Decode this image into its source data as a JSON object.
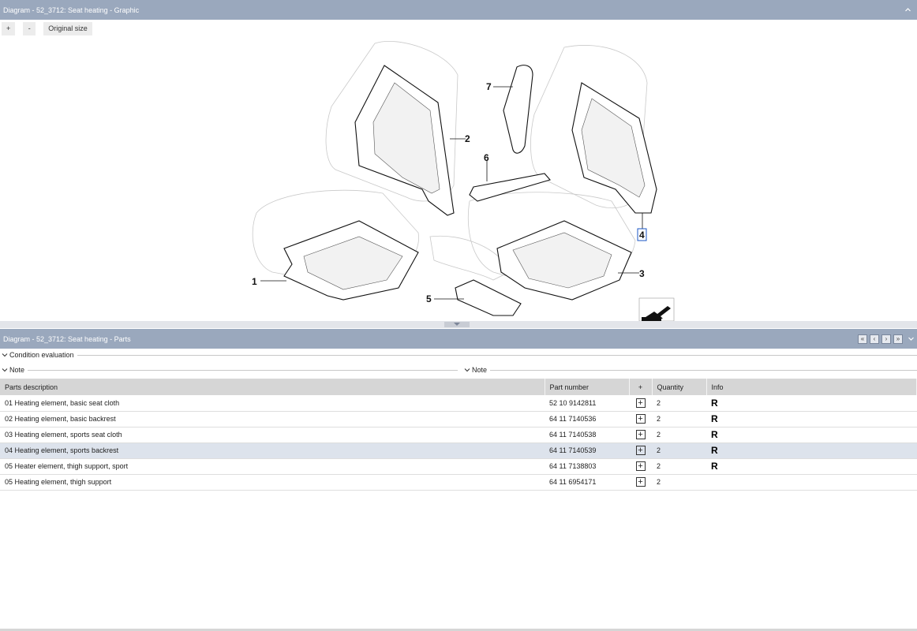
{
  "graphic_panel": {
    "title": "Diagram - 52_3712: Seat heating - Graphic",
    "zoom_in": "+",
    "zoom_out": "-",
    "original_size": "Original size",
    "callouts": [
      "1",
      "2",
      "3",
      "4",
      "5",
      "6",
      "7"
    ]
  },
  "parts_panel": {
    "title": "Diagram - 52_3712: Seat heating - Parts",
    "pager": [
      "«",
      "‹",
      "›",
      "»"
    ],
    "condition_evaluation": "Condition evaluation",
    "note_left": "Note",
    "note_right": "Note",
    "columns": {
      "description": "Parts description",
      "part_number": "Part number",
      "plus": "+",
      "quantity": "Quantity",
      "info": "Info"
    },
    "rows": [
      {
        "description": "01 Heating element, basic seat cloth",
        "part_number": "52 10 9142811",
        "quantity": "2",
        "info": "R"
      },
      {
        "description": "02 Heating element, basic backrest",
        "part_number": "64 11 7140536",
        "quantity": "2",
        "info": "R"
      },
      {
        "description": "03 Heating element, sports seat cloth",
        "part_number": "64 11 7140538",
        "quantity": "2",
        "info": "R"
      },
      {
        "description": "04 Heating element, sports backrest",
        "part_number": "64 11 7140539",
        "quantity": "2",
        "info": "R"
      },
      {
        "description": "05 Heater element, thigh support, sport",
        "part_number": "64 11 7138803",
        "quantity": "2",
        "info": "R"
      },
      {
        "description": "05 Heating element, thigh support",
        "part_number": "64 11 6954171",
        "quantity": "2",
        "info": ""
      }
    ],
    "selected_row": 3
  },
  "colors": {
    "header_bg": "#9aa8bd",
    "selected_row": "#dde3ec",
    "table_header": "#d6d6d6"
  }
}
